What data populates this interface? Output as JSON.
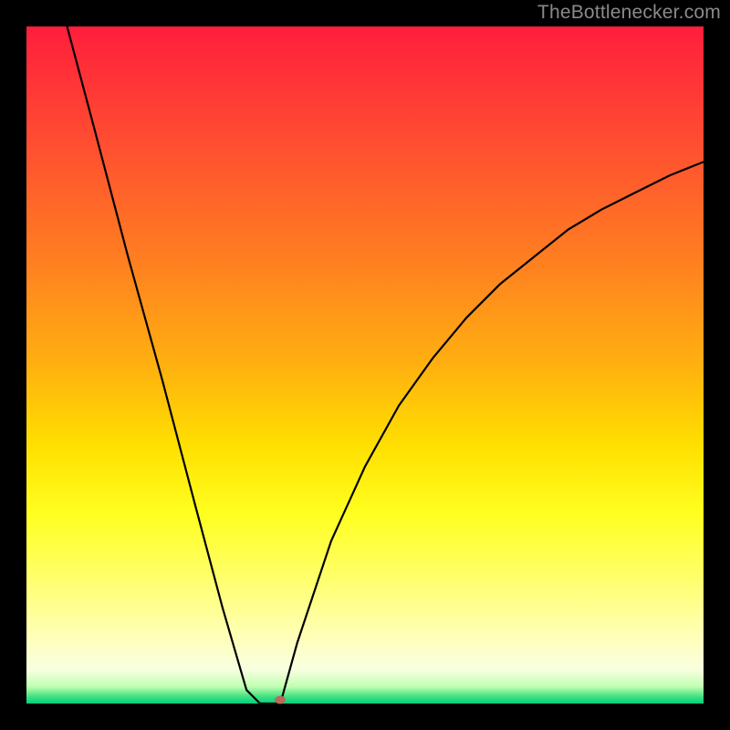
{
  "watermark": "TheBottlenecker.com",
  "chart_data": {
    "type": "line",
    "title": "",
    "xlabel": "",
    "ylabel": "",
    "xlim": [
      0,
      100
    ],
    "ylim": [
      0,
      100
    ],
    "gradient_stops": [
      {
        "pos": 0,
        "color": "#ff1e3c"
      },
      {
        "pos": 18,
        "color": "#ff5030"
      },
      {
        "pos": 35,
        "color": "#ff8020"
      },
      {
        "pos": 50,
        "color": "#ffb010"
      },
      {
        "pos": 62,
        "color": "#ffe000"
      },
      {
        "pos": 72,
        "color": "#ffff20"
      },
      {
        "pos": 82,
        "color": "#ffff70"
      },
      {
        "pos": 91,
        "color": "#ffffc0"
      },
      {
        "pos": 95,
        "color": "#f8ffe0"
      },
      {
        "pos": 97.5,
        "color": "#c0ffb0"
      },
      {
        "pos": 99,
        "color": "#40e080"
      },
      {
        "pos": 100,
        "color": "#00d080"
      }
    ],
    "series": [
      {
        "name": "left-branch",
        "x": [
          6,
          10,
          15,
          20,
          25,
          29,
          32.5,
          34.5
        ],
        "y": [
          100,
          85,
          66,
          48,
          29,
          14,
          2,
          0
        ]
      },
      {
        "name": "bottom-flat",
        "x": [
          34.5,
          37.5
        ],
        "y": [
          0,
          0
        ]
      },
      {
        "name": "right-branch",
        "x": [
          37.5,
          40,
          45,
          50,
          55,
          60,
          65,
          70,
          75,
          80,
          85,
          90,
          95,
          100
        ],
        "y": [
          0,
          9,
          24,
          35,
          44,
          51,
          57,
          62,
          66,
          70,
          73,
          75.5,
          78,
          80
        ]
      }
    ],
    "highlight_point": {
      "x": 37.5,
      "y": 0.6,
      "color": "#b96a5a"
    }
  }
}
